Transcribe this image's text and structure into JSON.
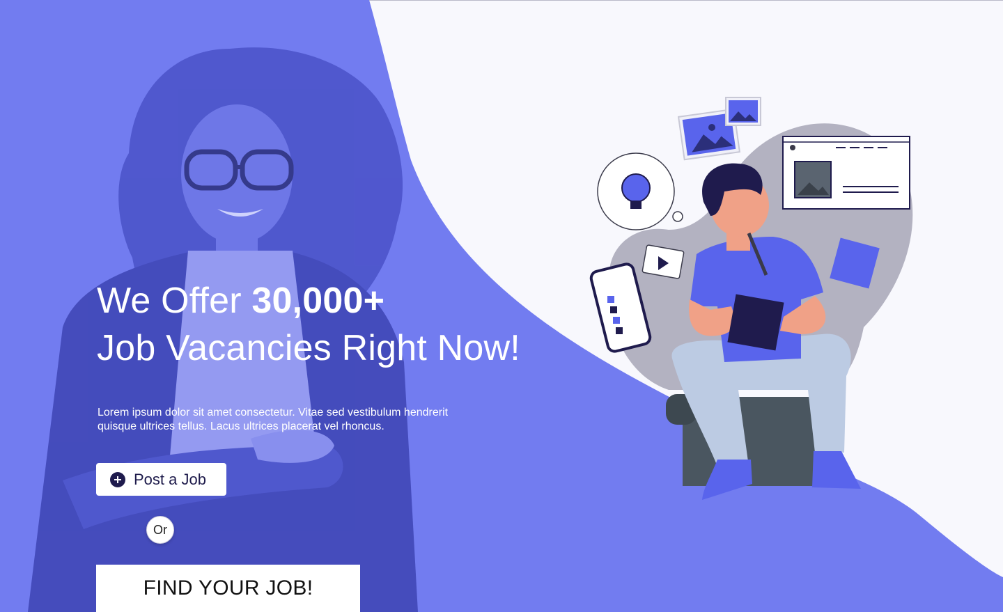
{
  "hero": {
    "title_prefix": "We Offer ",
    "title_number": "30,000+",
    "title_line2": "Job Vacancies Right Now!",
    "description": "Lorem ipsum dolor sit amet consectetur. Vitae sed vestibulum hendrerit quisque ultrices tellus. Lacus ultrices placerat vel rhoncus."
  },
  "actions": {
    "post_job_label": "Post a Job",
    "or_label": "Or",
    "find_job_label": "FIND YOUR JOB!"
  },
  "icons": {
    "post_job_icon": "plus-circle-icon"
  },
  "colors": {
    "accent": "#727cf0",
    "photo_overlay": "#5a63e0",
    "dark_text": "#1e1b4b",
    "illustration_blue": "#5964ec",
    "page_background": "#f8f8fd"
  }
}
